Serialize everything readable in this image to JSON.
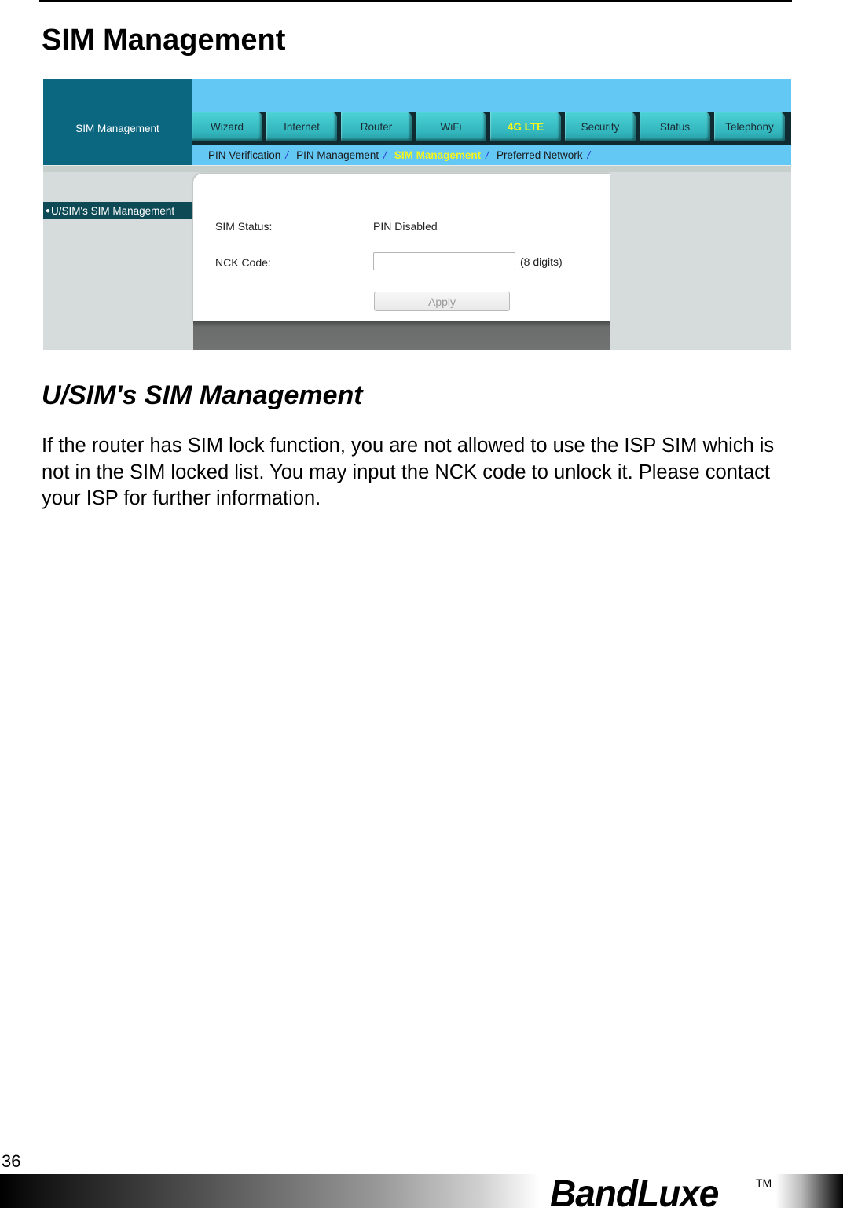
{
  "page": {
    "title": "SIM Management",
    "section_heading": "U/SIM's SIM Management",
    "body_text": "If the router has SIM lock function, you are not allowed to use the ISP SIM which is not in the SIM locked list. You may input the NCK code to unlock it. Please contact your ISP for further information.",
    "page_number": "36"
  },
  "footer": {
    "brand": "BandLuxe",
    "trademark": "TM"
  },
  "screenshot": {
    "left_header": "SIM Management",
    "tabs": [
      {
        "label": "Wizard",
        "active": false
      },
      {
        "label": "Internet",
        "active": false
      },
      {
        "label": "Router",
        "active": false
      },
      {
        "label": "WiFi",
        "active": false
      },
      {
        "label": "4G LTE",
        "active": true
      },
      {
        "label": "Security",
        "active": false
      },
      {
        "label": "Status",
        "active": false
      },
      {
        "label": "Telephony",
        "active": false
      }
    ],
    "subnav": [
      {
        "label": "PIN Verification",
        "active": false
      },
      {
        "label": "PIN Management",
        "active": false
      },
      {
        "label": "SIM Management",
        "active": true
      },
      {
        "label": "Preferred Network",
        "active": false
      }
    ],
    "subnav_separator": "/",
    "sidebar": {
      "items": [
        {
          "bullet": "●",
          "label": "U/SIM's SIM Management",
          "active": true
        }
      ]
    },
    "form": {
      "sim_status_label": "SIM Status:",
      "sim_status_value": "PIN Disabled",
      "nck_label": "NCK Code:",
      "nck_value": "",
      "nck_hint": "(8 digits)",
      "apply_label": "Apply"
    },
    "colors": {
      "header_dark": "#0b6680",
      "header_light": "#64c8f5",
      "tab": "#32b5bc",
      "active_text": "#f5f51e",
      "separator": "#2a3ccc"
    }
  }
}
